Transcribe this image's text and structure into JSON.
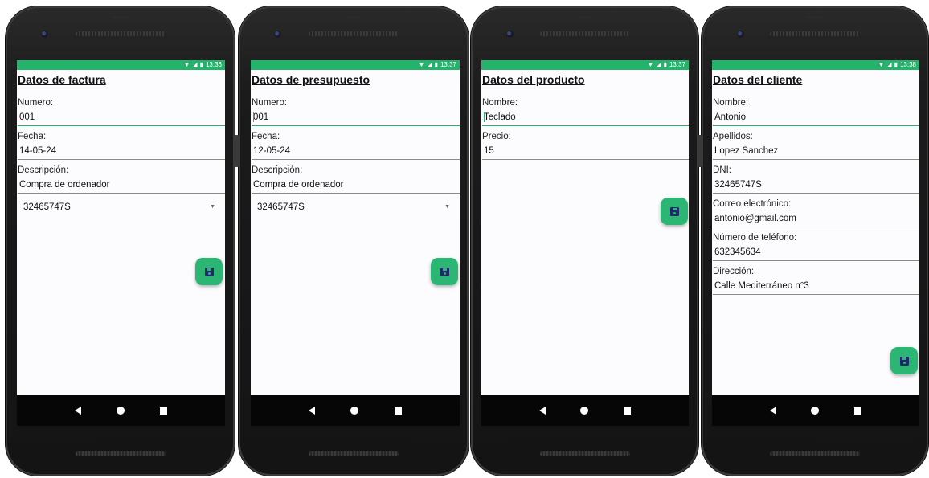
{
  "status_bar": {
    "time": [
      "13:36",
      "13:37",
      "13:37",
      "13:38"
    ],
    "wifi_icon": "wifi-icon",
    "signal_icon": "signal-icon",
    "battery_icon": "battery-icon"
  },
  "colors": {
    "accent": "#23b36a",
    "fab": "#2bb673",
    "fab_icon": "#1f2a6b"
  },
  "screens": [
    {
      "title": "Datos de factura",
      "fields": [
        {
          "label": "Numero:",
          "value": "001"
        },
        {
          "label": "Fecha:",
          "value": "14-05-24"
        },
        {
          "label": "Descripción:",
          "value": "Compra de ordenador"
        }
      ],
      "spinner": {
        "selected": "32465747S"
      },
      "fab_icon": "save-icon"
    },
    {
      "title": "Datos de presupuesto",
      "fields": [
        {
          "label": "Numero:",
          "value": "001"
        },
        {
          "label": "Fecha:",
          "value": "12-05-24"
        },
        {
          "label": "Descripción:",
          "value": "Compra de ordenador"
        }
      ],
      "spinner": {
        "selected": "32465747S"
      },
      "fab_icon": "save-icon"
    },
    {
      "title": "Datos del producto",
      "fields": [
        {
          "label": "Nombre:",
          "value": "Teclado"
        },
        {
          "label": "Precio:",
          "value": "15"
        }
      ],
      "fab_icon": "save-icon"
    },
    {
      "title": "Datos del cliente",
      "fields": [
        {
          "label": "Nombre:",
          "value": "Antonio"
        },
        {
          "label": "Apellidos:",
          "value": "Lopez Sanchez"
        },
        {
          "label": "DNI:",
          "value": "32465747S"
        },
        {
          "label": "Correo electrónico:",
          "value": "antonio@gmail.com"
        },
        {
          "label": "Número de teléfono:",
          "value": "632345634"
        },
        {
          "label": "Dirección:",
          "value": "Calle Mediterráneo n°3"
        }
      ],
      "fab_icon": "save-icon"
    }
  ],
  "nav_bar": {
    "back_icon": "back-icon",
    "home_icon": "home-icon",
    "recents_icon": "recents-icon"
  }
}
